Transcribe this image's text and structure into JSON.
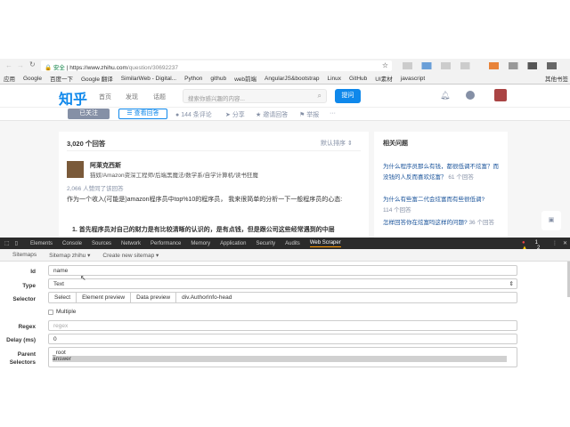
{
  "browser": {
    "secure_label": "安全",
    "url_host": "https://www.zhihu.com",
    "url_path": "/question/30692237",
    "bookmarks": [
      "应用",
      "Google",
      "百度一下",
      "Google 翻译",
      "SimilarWeb - Digital...",
      "Python",
      "github",
      "web前端",
      "AngularJS&bootstrap",
      "Linux",
      "GitHub",
      "UI素材",
      "javascript"
    ],
    "other_bookmarks": "其他书签"
  },
  "zhihu": {
    "logo": "知乎",
    "nav": [
      "首页",
      "发现",
      "话题"
    ],
    "search_placeholder": "搜索你感兴趣的内容...",
    "ask_button": "提问",
    "sub": {
      "followed": "已关注",
      "view_answers": "查看回答",
      "comments": "144 条评论",
      "share": "分享",
      "invite": "邀请回答",
      "report": "举报",
      "more": "···"
    },
    "answers_count": "3,020 个回答",
    "sort": "默认排序",
    "author": {
      "name": "阿莱克西斯",
      "bio": "猫奴/Amazon资深工程师/后端黑魔法/数学系/自学计算机/读书狂魔"
    },
    "votes": "2,066 人赞同了该回答",
    "content": "作为一个收入(可能是)amazon程序员中top%10的程序员， 我来很简单的分析一下一般程序员的心态:",
    "point1": "1. 首先程序员对自己的财力是有比较清晰的认识的，是有点钱，但是跟公司这些经常遇到的中层",
    "related_title": "相关问题",
    "related": [
      {
        "q": "为什么程序员那么有钱，都很低调不炫富？而没钱的人反而喜欢炫富？",
        "n": "61 个回答"
      },
      {
        "q": "为什么有些富二代会炫富而有些很低调?",
        "n": "114 个回答"
      },
      {
        "q": "怎样回答你在炫富吗这样的问题?",
        "n": "36 个回答"
      }
    ]
  },
  "devtools": {
    "tabs": [
      "Elements",
      "Console",
      "Sources",
      "Network",
      "Performance",
      "Memory",
      "Application",
      "Security",
      "Audits",
      "Web Scraper"
    ],
    "active": "Web Scraper",
    "errors": "1",
    "warnings": "2",
    "sub": [
      "Sitemaps",
      "Sitemap zhihu ▾",
      "Create new sitemap ▾"
    ],
    "form": {
      "id_label": "Id",
      "id_value": "name",
      "type_label": "Type",
      "type_value": "Text",
      "selector_label": "Selector",
      "select_btn": "Select",
      "element_preview": "Element preview",
      "data_preview": "Data preview",
      "selector_value": "div.AuthorInfo-head",
      "multiple": "Multiple",
      "regex_label": "Regex",
      "regex_placeholder": "regex",
      "delay_label": "Delay (ms)",
      "delay_value": "0",
      "parent_label": "Parent Selectors",
      "parents": [
        "_root",
        "answer"
      ]
    }
  }
}
